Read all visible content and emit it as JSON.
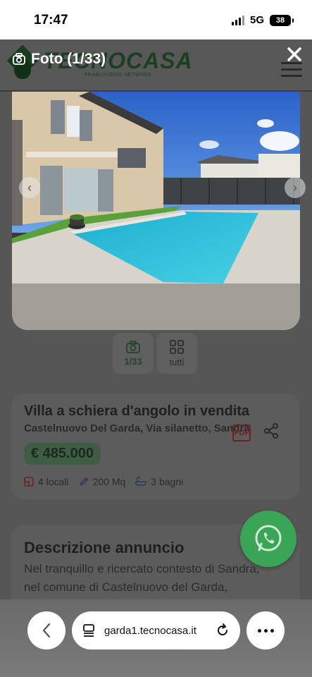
{
  "status_bar": {
    "time": "17:47",
    "network": "5G",
    "battery": "38"
  },
  "header": {
    "brand_name": "TECNOCASA",
    "brand_sub": "FRANCHISING NETWORK",
    "brand_mark": "®"
  },
  "lightbox": {
    "counter": "Foto (1/33)",
    "close_icon": "close-icon"
  },
  "gallery": {
    "thumbs": [
      {
        "label": "1/33",
        "icon": "camera-icon"
      },
      {
        "label": "tutti",
        "icon": "grid-icon"
      }
    ]
  },
  "listing": {
    "title": "Villa a schiera d'angolo in vendita",
    "address": "Castelnuovo Del Garda, Via silanetto, Sandrà",
    "price": "€ 485.000",
    "pdf_label": "PDF",
    "features": [
      {
        "label": "4 locali",
        "icon": "rooms-icon"
      },
      {
        "label": "200 Mq",
        "icon": "ruler-icon"
      },
      {
        "label": "3 bagni",
        "icon": "bathtub-icon"
      }
    ]
  },
  "description": {
    "heading": "Descrizione annuncio",
    "text": "Nel tranquillo e ricercato contesto di Sandra, nel comune di Castelnuovo del Garda,"
  },
  "browser": {
    "url": "garda1.tecnocasa.it"
  },
  "colors": {
    "brand_green": "#1c3f22",
    "whatsapp": "#3aa457",
    "pool": "#2fc0d6",
    "sky": "#2f6fd2"
  }
}
